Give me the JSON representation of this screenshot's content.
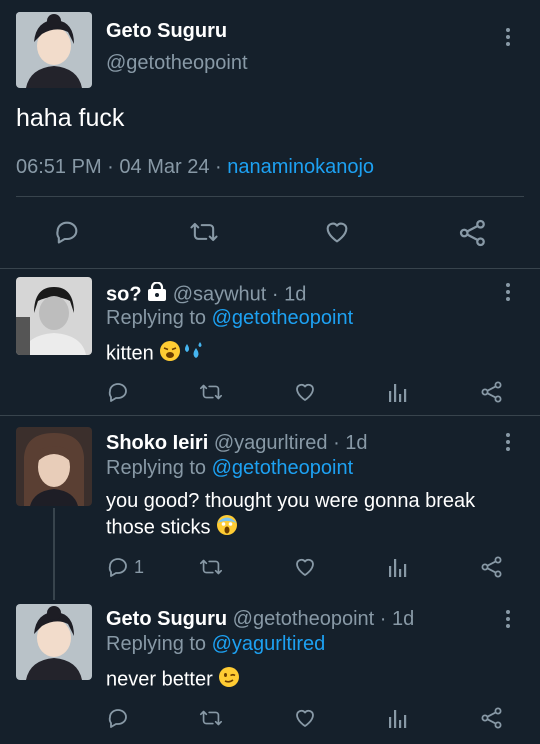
{
  "main_tweet": {
    "display_name": "Geto Suguru",
    "handle": "@getotheopoint",
    "text": "haha fuck",
    "time": "06:51 PM",
    "date": "04 Mar 24",
    "client": "nanaminokanojo",
    "sep1": "·",
    "sep2": "·"
  },
  "replies": [
    {
      "display_name": "so?",
      "handle": "@saywhut",
      "age": "1d",
      "replying_prefix": "Replying to",
      "replying_to": "@getotheopoint",
      "text": "kitten",
      "reply_count": ""
    },
    {
      "display_name": "Shoko Ieiri",
      "handle": "@yagurltired",
      "age": "1d",
      "replying_prefix": "Replying to",
      "replying_to": "@getotheopoint",
      "text_line1": "you good? thought you were gonna break",
      "text_line2": "those sticks",
      "reply_count": "1"
    },
    {
      "display_name": "Geto Suguru",
      "handle": "@getotheopoint",
      "age": "1d",
      "replying_prefix": "Replying to",
      "replying_to": "@yagurltired",
      "text": "never better",
      "reply_count": ""
    }
  ],
  "sep": "·",
  "colors": {
    "background": "#15202b",
    "muted": "#8899a6",
    "link": "#1da1f2",
    "divider": "#38444d"
  },
  "icons": [
    "reply-icon",
    "retweet-icon",
    "like-icon",
    "share-icon",
    "analytics-icon",
    "lock-icon",
    "kebab-menu-icon"
  ]
}
